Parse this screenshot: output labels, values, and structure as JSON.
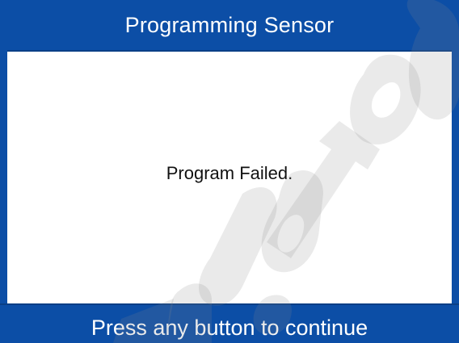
{
  "header": {
    "title": "Programming Sensor"
  },
  "message": {
    "text": "Program Failed."
  },
  "footer": {
    "prompt": "Press any button to continue"
  },
  "watermark": {
    "text": "autel"
  },
  "colors": {
    "bar_blue": "#0c4ea6",
    "text_white": "#ffffff",
    "text_dark": "#111111",
    "watermark_gray": "#8a8a8a"
  }
}
